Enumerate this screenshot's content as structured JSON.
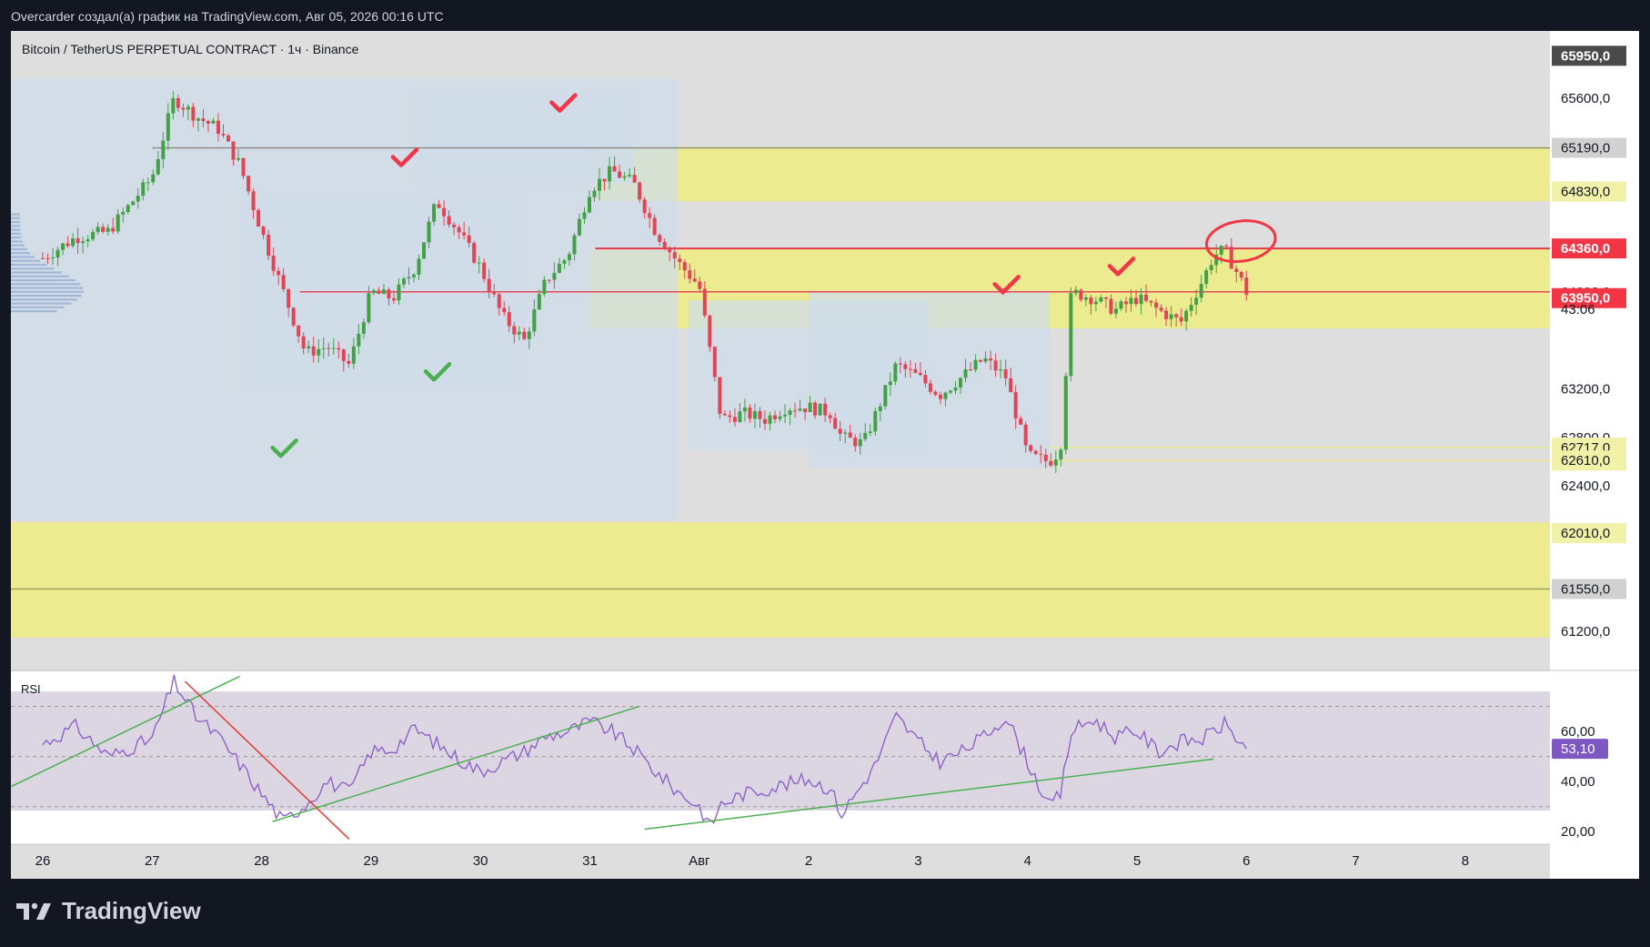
{
  "header": {
    "caption": "Overcarder создал(а) график на TradingView.com, Авг 05, 2026 00:16 UTC"
  },
  "symbol": {
    "title": "Bitcoin / TetherUS PERPETUAL CONTRACT · 1ч · Binance"
  },
  "brand": {
    "name": "TradingView"
  },
  "countdown": "43:06",
  "colors": {
    "background": "#131722",
    "pane": "#dedede",
    "zone_yellow": "#eceb8a",
    "bull": "#43a047",
    "bear": "#e04455",
    "rsi_line": "#8e62c9",
    "trendline_green": "#4caf50",
    "trendline_red": "#e53935"
  },
  "chart_data": {
    "type": "candlestick",
    "symbol": "BTCUSDT.P",
    "timeframe": "1h",
    "x_tick_labels": [
      "26",
      "27",
      "28",
      "29",
      "30",
      "31",
      "Авг",
      "2",
      "3",
      "4",
      "5",
      "6",
      "7",
      "8"
    ],
    "y_tick_labels": [
      "65600,0",
      "63200,0",
      "62800,0",
      "62400,0",
      "61200,0"
    ],
    "ylim": [
      61050,
      66050
    ],
    "price_tags": [
      {
        "label": "65950,0",
        "value": 65950,
        "style": "dark"
      },
      {
        "label": "65190,0",
        "value": 65190,
        "style": "gray"
      },
      {
        "label": "64830,0",
        "value": 64830,
        "style": "yellow"
      },
      {
        "label": "64360,0",
        "value": 64360,
        "style": "red"
      },
      {
        "label": "64002,0",
        "value": 64002,
        "style": "white"
      },
      {
        "label": "63950,0",
        "value": 63950,
        "style": "red"
      },
      {
        "label": "62717,0",
        "value": 62717,
        "style": "yellow"
      },
      {
        "label": "62610,0",
        "value": 62610,
        "style": "yellow"
      },
      {
        "label": "62010,0",
        "value": 62010,
        "style": "yellow"
      },
      {
        "label": "61550,0",
        "value": 61550,
        "style": "gray"
      }
    ],
    "zones": [
      {
        "from": 64750,
        "to": 65200
      },
      {
        "from": 63700,
        "to": 64360
      },
      {
        "from": 61150,
        "to": 62100
      }
    ],
    "horizontal_lines": [
      {
        "value": 64360,
        "color": "#e53950"
      },
      {
        "value": 64002,
        "color": "#e53950"
      },
      {
        "value": 65190,
        "color": "#888888"
      },
      {
        "value": 62717,
        "color": "#eceb8a"
      },
      {
        "value": 62610,
        "color": "#eceb8a"
      },
      {
        "value": 61550,
        "color": "#9a9a60"
      }
    ],
    "close_path": [
      [
        0.0,
        64280
      ],
      [
        0.3,
        64450
      ],
      [
        0.6,
        64500
      ],
      [
        1.0,
        64950
      ],
      [
        1.2,
        65600
      ],
      [
        1.4,
        65450
      ],
      [
        1.6,
        65350
      ],
      [
        1.8,
        65050
      ],
      [
        2.0,
        64500
      ],
      [
        2.2,
        64000
      ],
      [
        2.4,
        63500
      ],
      [
        2.6,
        63550
      ],
      [
        2.8,
        63400
      ],
      [
        3.0,
        64000
      ],
      [
        3.2,
        63950
      ],
      [
        3.4,
        64200
      ],
      [
        3.6,
        64750
      ],
      [
        3.8,
        64500
      ],
      [
        4.0,
        64200
      ],
      [
        4.2,
        63800
      ],
      [
        4.4,
        63600
      ],
      [
        4.6,
        64100
      ],
      [
        4.8,
        64300
      ],
      [
        5.0,
        64850
      ],
      [
        5.2,
        65000
      ],
      [
        5.4,
        64900
      ],
      [
        5.6,
        64500
      ],
      [
        5.8,
        64250
      ],
      [
        6.0,
        64050
      ],
      [
        6.1,
        63500
      ],
      [
        6.2,
        62950
      ],
      [
        6.4,
        63000
      ],
      [
        6.6,
        62950
      ],
      [
        6.8,
        63050
      ],
      [
        7.0,
        63050
      ],
      [
        7.2,
        63000
      ],
      [
        7.3,
        62800
      ],
      [
        7.5,
        62750
      ],
      [
        7.8,
        63400
      ],
      [
        8.0,
        63300
      ],
      [
        8.2,
        63150
      ],
      [
        8.4,
        63300
      ],
      [
        8.6,
        63450
      ],
      [
        8.8,
        63300
      ],
      [
        9.0,
        62650
      ],
      [
        9.2,
        62600
      ],
      [
        9.3,
        62700
      ],
      [
        9.4,
        64000
      ],
      [
        9.6,
        63950
      ],
      [
        9.8,
        63850
      ],
      [
        10.0,
        63950
      ],
      [
        10.2,
        63850
      ],
      [
        10.4,
        63750
      ],
      [
        10.6,
        64100
      ],
      [
        10.7,
        64300
      ],
      [
        10.8,
        64350
      ],
      [
        10.95,
        64100
      ],
      [
        11.0,
        64002
      ]
    ],
    "annotations": [
      {
        "type": "check",
        "color": "red",
        "x": 3.3,
        "price": 65100
      },
      {
        "type": "check",
        "color": "red",
        "x": 4.75,
        "price": 65550
      },
      {
        "type": "check",
        "color": "red",
        "x": 8.8,
        "price": 64050
      },
      {
        "type": "check",
        "color": "red",
        "x": 9.85,
        "price": 64200
      },
      {
        "type": "check",
        "color": "green",
        "x": 2.2,
        "price": 62700
      },
      {
        "type": "check",
        "color": "green",
        "x": 3.6,
        "price": 63330
      },
      {
        "type": "ellipse",
        "color": "red",
        "x": 10.95,
        "price": 64420
      }
    ],
    "rsi": {
      "label": "RSI",
      "value_tag": "53,10",
      "value": 53.1,
      "ylim": [
        15,
        84
      ],
      "tick_labels": [
        "60,00",
        "40,00",
        "20,00"
      ],
      "tick_values": [
        60,
        40,
        20
      ],
      "upper_band": 70,
      "mid_band": 50,
      "lower_band": 30,
      "path": [
        [
          0.0,
          55
        ],
        [
          0.3,
          62
        ],
        [
          0.6,
          50
        ],
        [
          1.0,
          57
        ],
        [
          1.2,
          80
        ],
        [
          1.4,
          66
        ],
        [
          1.6,
          58
        ],
        [
          1.8,
          47
        ],
        [
          2.0,
          35
        ],
        [
          2.2,
          24
        ],
        [
          2.4,
          31
        ],
        [
          2.6,
          40
        ],
        [
          2.8,
          36
        ],
        [
          3.0,
          52
        ],
        [
          3.2,
          53
        ],
        [
          3.4,
          61
        ],
        [
          3.6,
          55
        ],
        [
          3.8,
          49
        ],
        [
          4.0,
          44
        ],
        [
          4.2,
          48
        ],
        [
          4.4,
          52
        ],
        [
          4.6,
          58
        ],
        [
          4.8,
          60
        ],
        [
          5.0,
          64
        ],
        [
          5.2,
          60
        ],
        [
          5.4,
          53
        ],
        [
          5.6,
          44
        ],
        [
          5.8,
          36
        ],
        [
          6.0,
          30
        ],
        [
          6.1,
          22
        ],
        [
          6.2,
          31
        ],
        [
          6.4,
          35
        ],
        [
          6.6,
          37
        ],
        [
          6.8,
          39
        ],
        [
          7.0,
          41
        ],
        [
          7.2,
          37
        ],
        [
          7.3,
          27
        ],
        [
          7.6,
          46
        ],
        [
          7.8,
          66
        ],
        [
          8.0,
          56
        ],
        [
          8.2,
          48
        ],
        [
          8.4,
          52
        ],
        [
          8.6,
          58
        ],
        [
          8.8,
          66
        ],
        [
          9.0,
          48
        ],
        [
          9.2,
          30
        ],
        [
          9.3,
          35
        ],
        [
          9.4,
          60
        ],
        [
          9.6,
          65
        ],
        [
          9.8,
          58
        ],
        [
          10.0,
          60
        ],
        [
          10.2,
          52
        ],
        [
          10.4,
          56
        ],
        [
          10.6,
          57
        ],
        [
          10.8,
          63
        ],
        [
          11.0,
          53.1
        ]
      ],
      "trendlines": [
        {
          "color": "green",
          "from": [
            -0.3,
            38
          ],
          "to": [
            1.8,
            82
          ]
        },
        {
          "color": "red",
          "from": [
            1.3,
            80
          ],
          "to": [
            2.8,
            17
          ]
        },
        {
          "color": "green",
          "from": [
            2.1,
            24
          ],
          "to": [
            5.45,
            70
          ]
        },
        {
          "color": "green",
          "from": [
            5.5,
            21
          ],
          "to": [
            10.7,
            49
          ]
        }
      ]
    }
  }
}
